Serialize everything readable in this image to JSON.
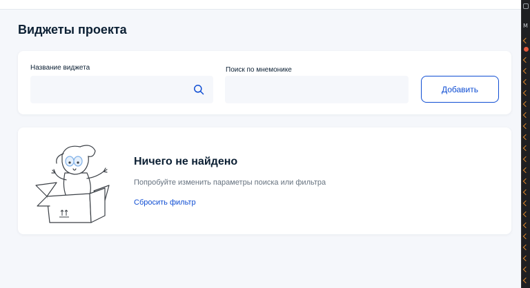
{
  "page": {
    "title": "Виджеты проекта"
  },
  "filters": {
    "widget_name_label": "Название виджета",
    "widget_name_value": "",
    "mnemonic_label": "Поиск по мнемонике",
    "mnemonic_value": "",
    "add_button_label": "Добавить"
  },
  "empty_state": {
    "title": "Ничего не найдено",
    "hint": "Попробуйте изменить параметры поиска или фильтра",
    "reset_link": "Сбросить фильтр"
  },
  "side_panel": {
    "letter": "M"
  },
  "colors": {
    "accent": "#0d4cd3",
    "background": "#f5f7fb",
    "text": "#0b1f33",
    "muted": "#66727f",
    "illustration_accent": "#7fb0e8"
  },
  "icons": [
    "search-icon",
    "dog-in-box-illustration",
    "this-side-up-icon"
  ]
}
